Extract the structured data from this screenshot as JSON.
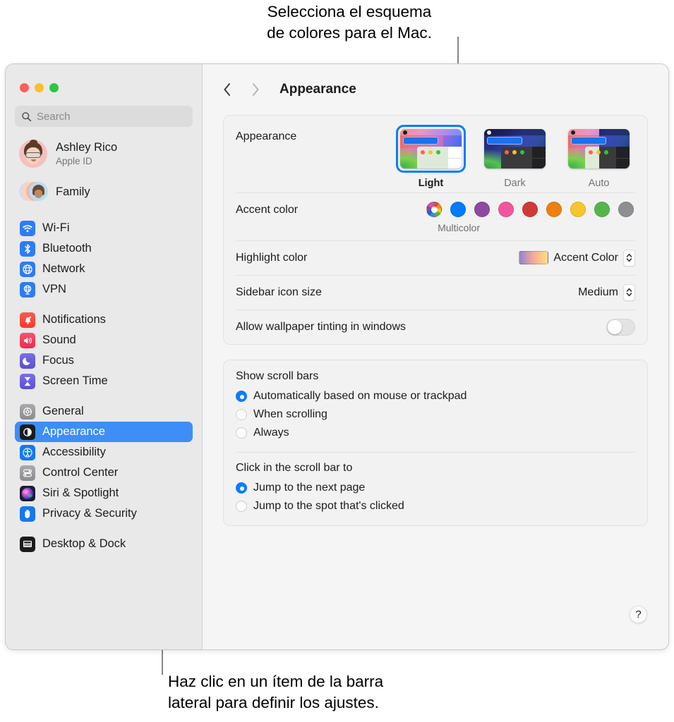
{
  "callouts": {
    "top": "Selecciona el esquema\nde colores para el Mac.",
    "bottom": "Haz clic en un ítem de la barra\nlateral para definir los ajustes."
  },
  "window": {
    "traffic_lights": [
      "close-red",
      "minimize-yellow",
      "zoom-green"
    ]
  },
  "sidebar": {
    "search": {
      "placeholder": "Search",
      "value": "",
      "icon": "search-icon"
    },
    "account": {
      "name": "Ashley Rico",
      "subtitle": "Apple ID",
      "avatar": "memoji-avatar"
    },
    "family": {
      "label": "Family",
      "avatar": "family-avatars"
    },
    "groups": [
      {
        "items": [
          {
            "label": "Wi-Fi",
            "icon": "wifi-icon",
            "color": "#2d7cf6"
          },
          {
            "label": "Bluetooth",
            "icon": "bluetooth-icon",
            "color": "#2d7cf6"
          },
          {
            "label": "Network",
            "icon": "globe-icon",
            "color": "#2d7cf6"
          },
          {
            "label": "VPN",
            "icon": "vpn-globe-icon",
            "color": "#2d7cf6"
          }
        ]
      },
      {
        "items": [
          {
            "label": "Notifications",
            "icon": "bell-icon",
            "color": "#f4453c"
          },
          {
            "label": "Sound",
            "icon": "speaker-icon",
            "color": "#f33a58"
          },
          {
            "label": "Focus",
            "icon": "moon-icon",
            "color": "#6258d8"
          },
          {
            "label": "Screen Time",
            "icon": "hourglass-icon",
            "color": "#6258d8"
          }
        ]
      },
      {
        "items": [
          {
            "label": "General",
            "icon": "gear-icon",
            "color": "#8e8e93"
          },
          {
            "label": "Appearance",
            "icon": "appearance-icon",
            "color": "#1c1c1e",
            "selected": true
          },
          {
            "label": "Accessibility",
            "icon": "accessibility-icon",
            "color": "#1479f0"
          },
          {
            "label": "Control Center",
            "icon": "control-center-icon",
            "color": "#8e8e93"
          },
          {
            "label": "Siri & Spotlight",
            "icon": "siri-icon",
            "color": "#2a2a4a"
          },
          {
            "label": "Privacy & Security",
            "icon": "hand-icon",
            "color": "#1479f0"
          }
        ]
      },
      {
        "items": [
          {
            "label": "Desktop & Dock",
            "icon": "desktop-dock-icon",
            "color": "#1c1c1e"
          }
        ]
      }
    ]
  },
  "toolbar": {
    "back_icon": "chevron-left-icon",
    "forward_icon": "chevron-right-icon",
    "title": "Appearance"
  },
  "settings": {
    "appearance": {
      "label": "Appearance",
      "selected": "Light",
      "options": [
        {
          "label": "Light",
          "selected": true
        },
        {
          "label": "Dark",
          "selected": false
        },
        {
          "label": "Auto",
          "selected": false
        }
      ]
    },
    "accent_color": {
      "label": "Accent color",
      "caption": "Multicolor",
      "selected": "Multicolor",
      "swatches": [
        {
          "name": "Multicolor",
          "color": "multicolor"
        },
        {
          "name": "Blue",
          "color": "#007aff"
        },
        {
          "name": "Purple",
          "color": "#8e4a9e"
        },
        {
          "name": "Pink",
          "color": "#f2559e"
        },
        {
          "name": "Red",
          "color": "#ce3a38"
        },
        {
          "name": "Orange",
          "color": "#ee8012"
        },
        {
          "name": "Yellow",
          "color": "#f6c62f"
        },
        {
          "name": "Green",
          "color": "#56b548"
        },
        {
          "name": "Graphite",
          "color": "#8e8e93"
        }
      ]
    },
    "highlight_color": {
      "label": "Highlight color",
      "value": "Accent Color"
    },
    "sidebar_icon_size": {
      "label": "Sidebar icon size",
      "value": "Medium"
    },
    "wallpaper_tinting": {
      "label": "Allow wallpaper tinting in windows",
      "enabled": false
    },
    "show_scroll_bars": {
      "title": "Show scroll bars",
      "options": [
        {
          "label": "Automatically based on mouse or trackpad",
          "selected": true
        },
        {
          "label": "When scrolling",
          "selected": false
        },
        {
          "label": "Always",
          "selected": false
        }
      ]
    },
    "click_scroll_bar": {
      "title": "Click in the scroll bar to",
      "options": [
        {
          "label": "Jump to the next page",
          "selected": true
        },
        {
          "label": "Jump to the spot that's clicked",
          "selected": false
        }
      ]
    },
    "help": {
      "label": "?"
    }
  }
}
